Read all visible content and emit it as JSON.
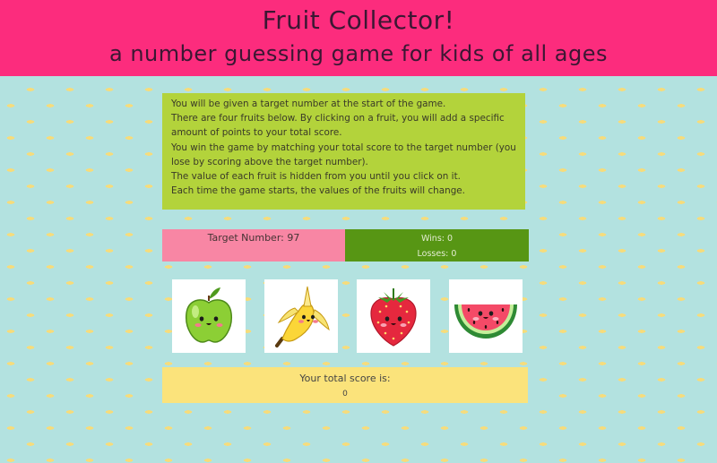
{
  "header": {
    "title": "Fruit Collector!",
    "subtitle": "a number guessing game for kids of all ages"
  },
  "instructions": [
    "You will be given a target number at the start of the game.",
    "There are four fruits below. By clicking on a fruit, you will add a specific amount of points to your total score.",
    "You win the game by matching your total score to the target number (you lose by scoring above the target number).",
    "The value of each fruit is hidden from you until you click on it.",
    "Each time the game starts, the values of the fruits will change."
  ],
  "target": {
    "label": "Target Number: 97"
  },
  "record": {
    "wins": "Wins: 0",
    "losses": "Losses: 0"
  },
  "fruits": [
    {
      "name": "apple"
    },
    {
      "name": "banana"
    },
    {
      "name": "strawberry"
    },
    {
      "name": "watermelon"
    }
  ],
  "score": {
    "label": "Your total score is:",
    "value": "0"
  },
  "colors": {
    "header": "#fc2c7d",
    "instructions": "#b3d33b",
    "target": "#f886a4",
    "record": "#579614",
    "score": "#fbe37b",
    "background": "#b3e2e0"
  }
}
